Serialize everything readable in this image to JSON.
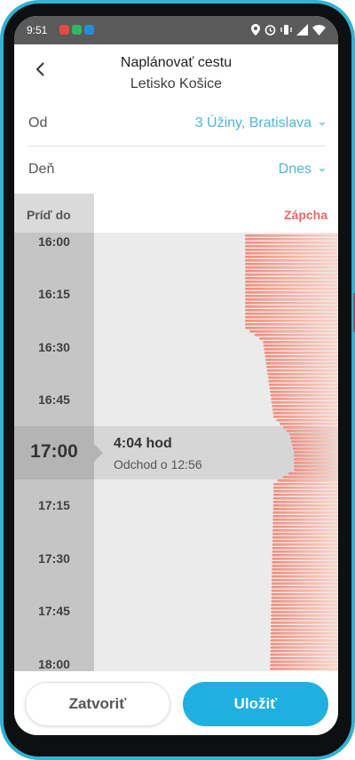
{
  "status_bar": {
    "time": "9:51",
    "notification_icons": [
      "app-red-icon",
      "app-green-icon",
      "app-blue-icon"
    ],
    "system_icons": [
      "location-icon",
      "alarm-icon",
      "vibrate-icon",
      "signal-icon",
      "wifi-icon"
    ]
  },
  "header": {
    "title": "Naplánovať cestu",
    "subtitle": "Letisko Košice",
    "back_icon": "chevron-left-icon"
  },
  "form": {
    "from_label": "Od",
    "from_value": "3 Úžiny, Bratislava",
    "day_label": "Deň",
    "day_value": "Dnes"
  },
  "table_header": {
    "arrive_label": "Príď do",
    "traffic_label": "Zápcha"
  },
  "colors": {
    "accent": "#1fb0e0",
    "link": "#4fb6d6",
    "traffic_label": "#e86767",
    "traffic_bar_deep": "#f58b7a",
    "traffic_bar_light": "#fcd6cc"
  },
  "time_slots": [
    "16:00",
    "16:15",
    "16:30",
    "16:45",
    "17:00",
    "17:15",
    "17:30",
    "17:45",
    "18:00"
  ],
  "selected": {
    "time": "17:00",
    "duration": "4:04 hod",
    "departure": "Odchod o 12:56"
  },
  "buttons": {
    "close": "Zatvoriť",
    "save": "Uložiť"
  }
}
